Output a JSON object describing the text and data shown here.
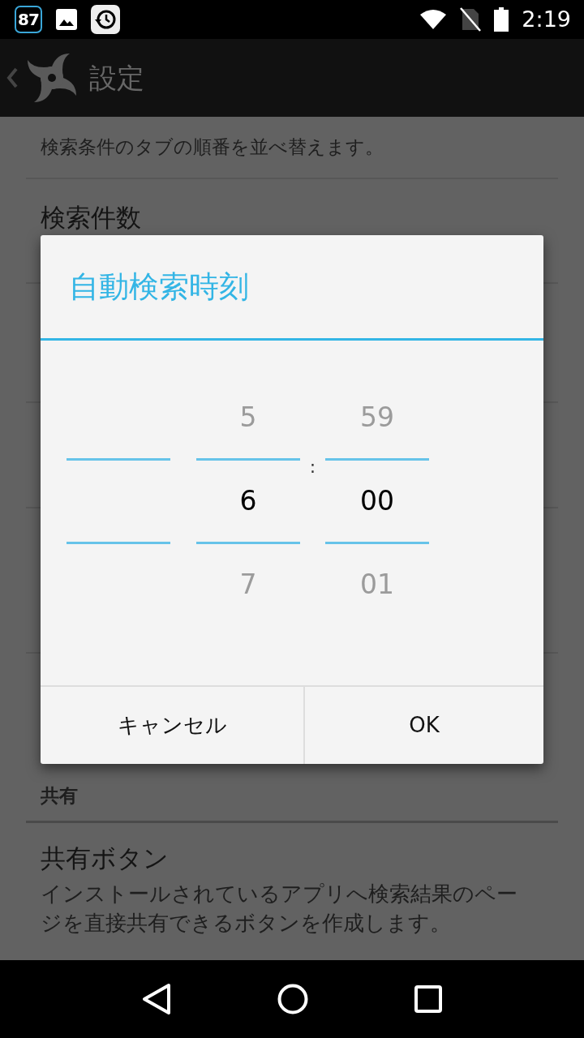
{
  "status_bar": {
    "badge": "87",
    "time": "2:19"
  },
  "app_bar": {
    "title": "設定"
  },
  "settings_top": [
    {
      "kind": "summary",
      "text": "検索条件のタブの順番を並べ替えます。"
    },
    {
      "kind": "title",
      "text": "検索件数"
    }
  ],
  "dialog": {
    "title": "自動検索時刻",
    "columns": [
      {
        "kind": "blank"
      },
      {
        "kind": "number",
        "above": "5",
        "value": "6",
        "below": "7"
      },
      {
        "kind": "number",
        "above": "59",
        "value": "00",
        "below": "01"
      }
    ],
    "separator": ":",
    "buttons": [
      "キャンセル",
      "OK"
    ]
  },
  "settings_bottom": {
    "category": "共有",
    "item": {
      "title": "共有ボタン",
      "summary": "インストールされているアプリへ検索結果のページを直接共有できるボタンを作成します。"
    }
  }
}
